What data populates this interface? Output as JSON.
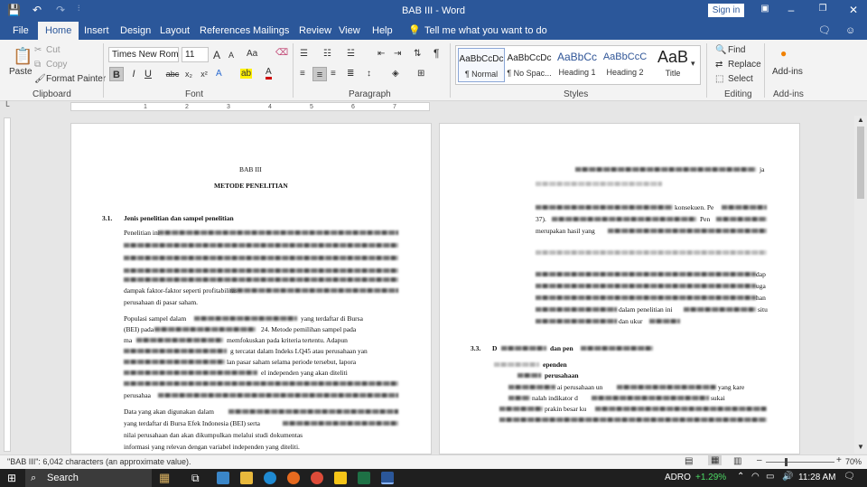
{
  "window": {
    "title": "BAB III  -  Word",
    "signin_label": "Sign in",
    "minimize_icon": "minimize-icon",
    "maximize_icon": "restore-icon",
    "close_icon": "close-icon"
  },
  "quick_access": {
    "save_icon": "save-icon",
    "undo_icon": "undo-icon",
    "redo_icon": "redo-icon",
    "customize_icon": "customize-icon"
  },
  "tabs": [
    {
      "label": "File"
    },
    {
      "label": "Home"
    },
    {
      "label": "Insert"
    },
    {
      "label": "Design"
    },
    {
      "label": "Layout"
    },
    {
      "label": "References"
    },
    {
      "label": "Mailings"
    },
    {
      "label": "Review"
    },
    {
      "label": "View"
    },
    {
      "label": "Help"
    }
  ],
  "tellme": "Tell me what you want to do",
  "clipboard": {
    "paste": "Paste",
    "cut": "Cut",
    "copy": "Copy",
    "format_painter": "Format Painter",
    "label": "Clipboard"
  },
  "font": {
    "name": "Times New Roma",
    "size": "11",
    "bold": "B",
    "italic": "I",
    "underline": "U",
    "strike": "abc",
    "subscript": "x₂",
    "superscript": "x²",
    "grow": "A",
    "shrink": "A",
    "case": "Aa",
    "label": "Font"
  },
  "paragraph": {
    "label": "Paragraph",
    "pilcrow": "¶"
  },
  "styles": {
    "label": "Styles",
    "items": [
      {
        "sample": "AaBbCcDc",
        "name": "¶ Normal"
      },
      {
        "sample": "AaBbCcDc",
        "name": "¶ No Spac..."
      },
      {
        "sample": "AaBbCc",
        "name": "Heading 1"
      },
      {
        "sample": "AaBbCcC",
        "name": "Heading 2"
      },
      {
        "sample": "AaB",
        "name": "Title"
      }
    ]
  },
  "editing": {
    "find": "Find",
    "replace": "Replace",
    "select": "Select",
    "label": "Editing"
  },
  "addins": {
    "button": "Add-ins",
    "label": "Add-ins"
  },
  "ruler": {
    "numbers": [
      "1",
      "2",
      "3",
      "4",
      "5",
      "6",
      "7"
    ]
  },
  "page1": {
    "heading1": "BAB III",
    "heading2": "METODE PENELITIAN",
    "section_num": "3.1.",
    "section_title": "Jenis penelitian dan sampel penelitian",
    "p1_start": "Penelitian ini",
    "line_a": "dampak faktor-faktor seperti profitabilitas",
    "line_b": "perusahaan di pasar saham.",
    "line_c1": "Populasi sampel dalam",
    "line_c2": "yang terdaftar di Bursa",
    "line_d1": "(BEI) pada",
    "line_d2": "24. Metode pemilihan sampel pada",
    "line_e1": "ma",
    "line_e2": "memfokuskan pada kriteria tertentu. Adapun",
    "line_f": "g tercatat dalam Indeks LQ45 atau perusahaan yan",
    "line_g": "lan pasar saham selama periode tersebut, lapora",
    "line_h": "el independen yang akan diteliti",
    "line_i": "perusahaa",
    "p2_1": "Data yang akan digunakan dalam",
    "p2_2": "yang terdaftar di Bursa Efek Indonesia (BEI) serta",
    "p2_3": "nilai perusahaan dan akan dikumpulkan melalui studi dokumentas",
    "p2_4": "informasi yang relevan dengan variabel independen yang diteliti."
  },
  "page2": {
    "l1": "ja",
    "l2": "konsekuen. Pe",
    "l3a": "37).",
    "l3b": "Pen",
    "l4": "merupakan hasil yang",
    "l5": "dap",
    "l6": "uga",
    "l7": "han",
    "l8": "situ",
    "l9": "dalam penelitian ini",
    "l10": "dan ukur",
    "section_num": "3.3.",
    "section_a": "D",
    "section_b": "dan pen",
    "sub1": "ependen",
    "sub2": "perusahaan",
    "l11": "ai perusahaan un",
    "l11b": "yang kare",
    "l12": "nalah indikator d",
    "l12b": "sukai",
    "l13": "prakin besar ku"
  },
  "status": {
    "words": "\"BAB III\": 6,042 characters (an approximate value).",
    "zoom": "70%"
  },
  "taskbar": {
    "search": "Search",
    "ticker": "ADRO",
    "change": "+1.29%",
    "time": "11:28 AM",
    "ticker_color": "#ffffff",
    "change_color": "#4cd964"
  }
}
